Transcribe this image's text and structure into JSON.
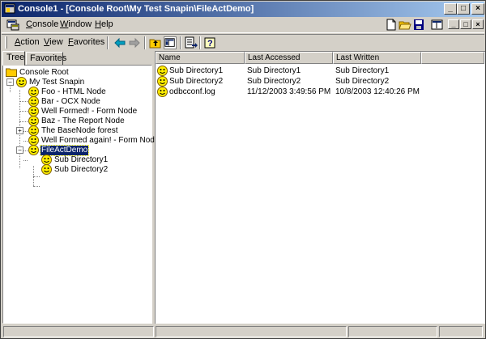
{
  "window": {
    "title": "Console1 - [Console Root\\My Test Snapin\\FileActDemo]",
    "colors": {
      "title_start": "#0a246a",
      "title_end": "#a6caf0",
      "selection": "#0a246a",
      "smiley": "#ffee00"
    }
  },
  "caption_buttons": {
    "minimize": "_",
    "maximize": "□",
    "close": "×"
  },
  "menubar": {
    "items": [
      {
        "key": "C",
        "rest": "onsole"
      },
      {
        "key": "W",
        "rest": "indow"
      },
      {
        "key": "H",
        "rest": "elp"
      }
    ]
  },
  "toolbar": {
    "items": [
      {
        "key": "A",
        "rest": "ction"
      },
      {
        "key": "V",
        "rest": "iew"
      },
      {
        "key": "F",
        "rest": "avorites"
      }
    ],
    "icons": [
      "back-arrow-icon",
      "forward-arrow-icon",
      "up-folder-icon",
      "show-hide-tree-icon",
      "export-list-icon",
      "help-icon"
    ]
  },
  "tabs": [
    {
      "label": "Tree",
      "active": true
    },
    {
      "label": "Favorites",
      "active": false
    }
  ],
  "tree": {
    "root": "Console Root",
    "snapin": "My Test Snapin",
    "nodes": [
      "Foo - HTML Node",
      "Bar - OCX Node",
      "Well Formed! - Form Node",
      "Baz - The Report Node",
      "The BaseNode forest",
      "Well Formed again! - Form Node",
      "FileActDemo"
    ],
    "selected": "FileActDemo",
    "children": [
      "Sub Directory1",
      "Sub Directory2"
    ]
  },
  "list": {
    "columns": [
      "Name",
      "Last Accessed",
      "Last Written"
    ],
    "rows": [
      [
        "Sub Directory1",
        "Sub Directory1",
        "Sub Directory1"
      ],
      [
        "Sub Directory2",
        "Sub Directory2",
        "Sub Directory2"
      ],
      [
        "odbcconf.log",
        "11/12/2003 3:49:56 PM",
        "10/8/2003 12:40:26 PM"
      ]
    ]
  }
}
